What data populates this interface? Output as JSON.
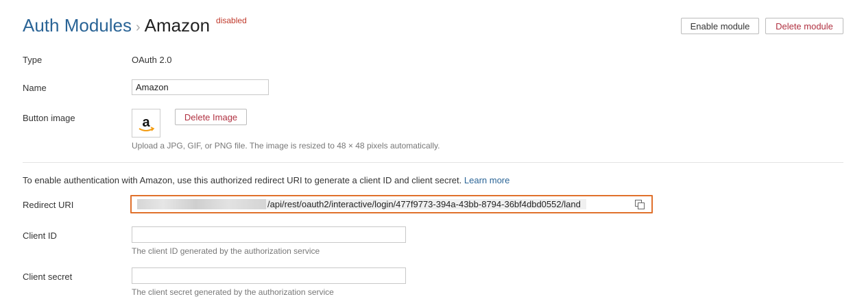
{
  "breadcrumb": {
    "parent": "Auth Modules",
    "separator": "›",
    "current": "Amazon",
    "status": "disabled"
  },
  "actions": {
    "enable_label": "Enable module",
    "delete_label": "Delete module"
  },
  "fields": {
    "type_label": "Type",
    "type_value": "OAuth 2.0",
    "name_label": "Name",
    "name_value": "Amazon",
    "button_image_label": "Button image",
    "button_image_logo": "a",
    "delete_image_label": "Delete Image",
    "button_image_help": "Upload a JPG, GIF, or PNG file. The image is resized to 48 × 48 pixels automatically."
  },
  "redirect": {
    "info_text": "To enable authentication with Amazon, use this authorized redirect URI to generate a client ID and client secret.",
    "learn_more": "Learn more",
    "label": "Redirect URI",
    "uri_suffix": "/api/rest/oauth2/interactive/login/477f9773-394a-43bb-8794-36bf4dbd0552/land",
    "copy_icon": "copy-icon"
  },
  "client": {
    "id_label": "Client ID",
    "id_value": "",
    "id_help": "The client ID generated by the authorization service",
    "secret_label": "Client secret",
    "secret_value": "",
    "secret_help": "The client secret generated by the authorization service"
  },
  "colors": {
    "link": "#2a6496",
    "danger": "#b03040",
    "highlight_border": "#e0702b",
    "amazon_smile": "#f39c12"
  }
}
